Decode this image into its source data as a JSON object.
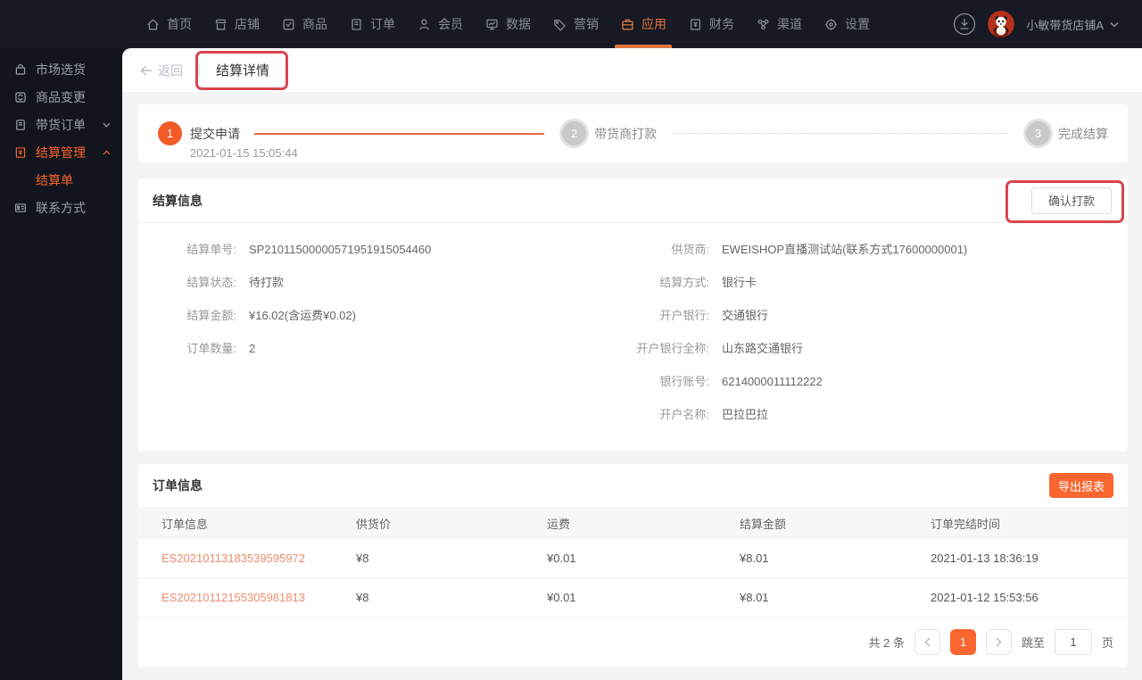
{
  "navbar": {
    "items": [
      {
        "label": "首页",
        "icon": "home-icon"
      },
      {
        "label": "店铺",
        "icon": "shop-icon"
      },
      {
        "label": "商品",
        "icon": "goods-icon"
      },
      {
        "label": "订单",
        "icon": "order-icon"
      },
      {
        "label": "会员",
        "icon": "member-icon"
      },
      {
        "label": "数据",
        "icon": "data-icon"
      },
      {
        "label": "营销",
        "icon": "marketing-icon"
      },
      {
        "label": "应用",
        "icon": "app-icon",
        "active": true
      },
      {
        "label": "财务",
        "icon": "finance-icon"
      },
      {
        "label": "渠道",
        "icon": "channel-icon"
      },
      {
        "label": "设置",
        "icon": "settings-icon"
      }
    ],
    "store_name": "小敏带货店铺A",
    "right_icons": [
      "download-icon",
      "avatar",
      "chevron-down-icon"
    ]
  },
  "sidebar": {
    "items": [
      {
        "label": "市场选货",
        "icon": "market-icon"
      },
      {
        "label": "商品变更",
        "icon": "goods-change-icon"
      },
      {
        "label": "带货订单",
        "icon": "carry-order-icon",
        "chevron": "down"
      },
      {
        "label": "结算管理",
        "icon": "settlement-icon",
        "chevron": "up",
        "active": true
      },
      {
        "label": "结算单",
        "sub": true,
        "active": true
      },
      {
        "label": "联系方式",
        "icon": "contact-icon"
      }
    ]
  },
  "header": {
    "back_label": "返回",
    "title": "结算详情"
  },
  "steps": [
    {
      "num": "1",
      "label": "提交申请",
      "time": "2021-01-15 15:05:44",
      "state": "done"
    },
    {
      "num": "2",
      "label": "带货商打款",
      "state": "todo"
    },
    {
      "num": "3",
      "label": "完成结算",
      "state": "todo"
    }
  ],
  "settlement": {
    "card_title": "结算信息",
    "confirm_button": "确认打款",
    "left_fields": [
      {
        "label": "结算单号:",
        "value": "SP21011500000571951915054460"
      },
      {
        "label": "结算状态:",
        "value": "待打款"
      },
      {
        "label": "结算金额:",
        "value": "¥16.02(含运费¥0.02)"
      },
      {
        "label": "订单数量:",
        "value": "2"
      }
    ],
    "right_fields": [
      {
        "label": "供货商:",
        "value": "EWEISHOP直播测试站(联系方式17600000001)"
      },
      {
        "label": "结算方式:",
        "value": "银行卡"
      },
      {
        "label": "开户银行:",
        "value": "交通银行"
      },
      {
        "label": "开户银行全称:",
        "value": "山东路交通银行"
      },
      {
        "label": "银行账号:",
        "value": "6214000011112222"
      },
      {
        "label": "开户名称:",
        "value": "巴拉巴拉"
      }
    ]
  },
  "orders": {
    "card_title": "订单信息",
    "export_button": "导出报表",
    "columns": [
      "订单信息",
      "供货价",
      "运费",
      "结算金额",
      "订单完结时间"
    ],
    "rows": [
      {
        "order_no": "ES20210113183539595972",
        "supply_price": "¥8",
        "shipping": "¥0.01",
        "amount": "¥8.01",
        "finish_time": "2021-01-13 18:36:19"
      },
      {
        "order_no": "ES20210112155305981813",
        "supply_price": "¥8",
        "shipping": "¥0.01",
        "amount": "¥8.01",
        "finish_time": "2021-01-12 15:53:56"
      }
    ],
    "pagination": {
      "total": "共 2 条",
      "prev": "‹",
      "current": "1",
      "next": "›",
      "jump_label": "跳至",
      "jump_value": "1",
      "page_label": "页"
    }
  },
  "colors": {
    "accent": "#f9662f",
    "annotation": "#d8454d",
    "nav_active": "#e0743f"
  }
}
